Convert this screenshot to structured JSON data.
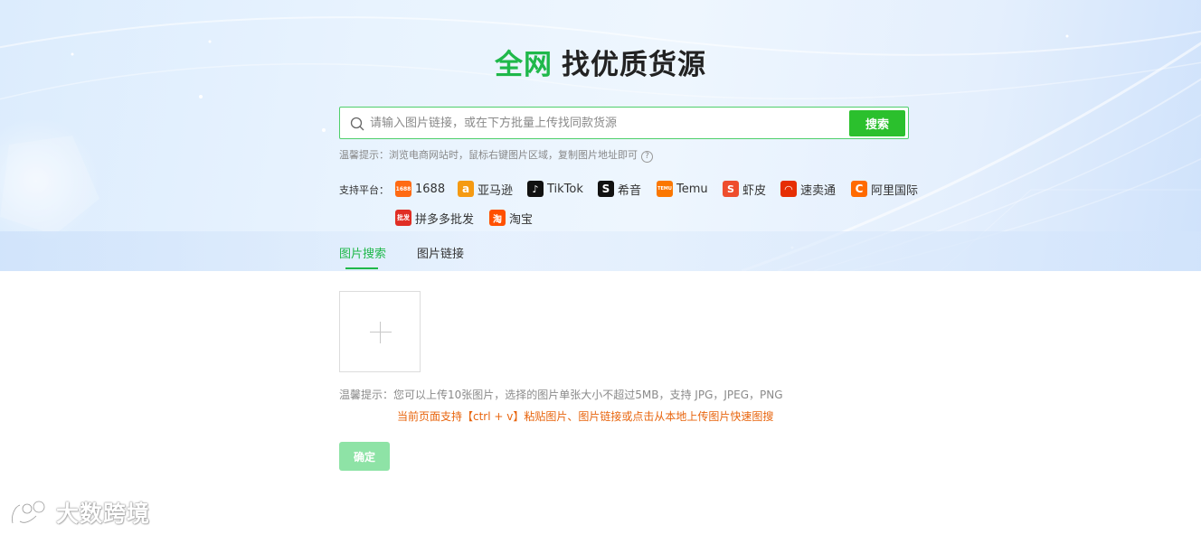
{
  "hero": {
    "title_accent": "全网",
    "title_rest": "找优质货源"
  },
  "search": {
    "placeholder": "请输入图片链接，或在下方批量上传找同款货源",
    "value": "",
    "button_label": "搜索",
    "icon": "search-icon"
  },
  "tip": {
    "text": "温馨提示：浏览电商网站时，鼠标右键图片区域，复制图片地址即可",
    "help_icon": "?"
  },
  "platforms": {
    "label": "支持平台：",
    "items": [
      {
        "name": "1688",
        "icon_text": "1688",
        "color": "#ff6a13"
      },
      {
        "name": "亚马逊",
        "icon_text": "a",
        "color": "#f59a12"
      },
      {
        "name": "TikTok",
        "icon_text": "♪",
        "color": "#111111"
      },
      {
        "name": "希音",
        "icon_text": "S",
        "color": "#111111"
      },
      {
        "name": "Temu",
        "icon_text": "TEMU",
        "color": "#fb7701"
      },
      {
        "name": "虾皮",
        "icon_text": "S",
        "color": "#ee4d2d"
      },
      {
        "name": "速卖通",
        "icon_text": "◠",
        "color": "#e62e04"
      },
      {
        "name": "阿里国际",
        "icon_text": "C",
        "color": "#ff6a00"
      },
      {
        "name": "拼多多批发",
        "icon_text": "批发",
        "color": "#e02e24"
      },
      {
        "name": "淘宝",
        "icon_text": "淘",
        "color": "#ff5000"
      }
    ]
  },
  "tabs": [
    {
      "label": "图片搜索",
      "active": true
    },
    {
      "label": "图片链接",
      "active": false
    }
  ],
  "upload": {
    "icon": "plus-icon"
  },
  "notes": {
    "line1": "温馨提示：您可以上传10张图片，选择的图片单张大小不超过5MB，支持 JPG，JPEG，PNG",
    "line2": "当前页面支持【ctrl + v】粘贴图片、图片链接或点击从本地上传图片快速图搜"
  },
  "confirm_label": "确定",
  "watermark": {
    "text": "大数跨境"
  },
  "colors": {
    "accent_green": "#1fb84a",
    "button_green": "#2bc02d",
    "confirm_disabled": "#8ee3a6",
    "note_orange": "#e8650e"
  }
}
